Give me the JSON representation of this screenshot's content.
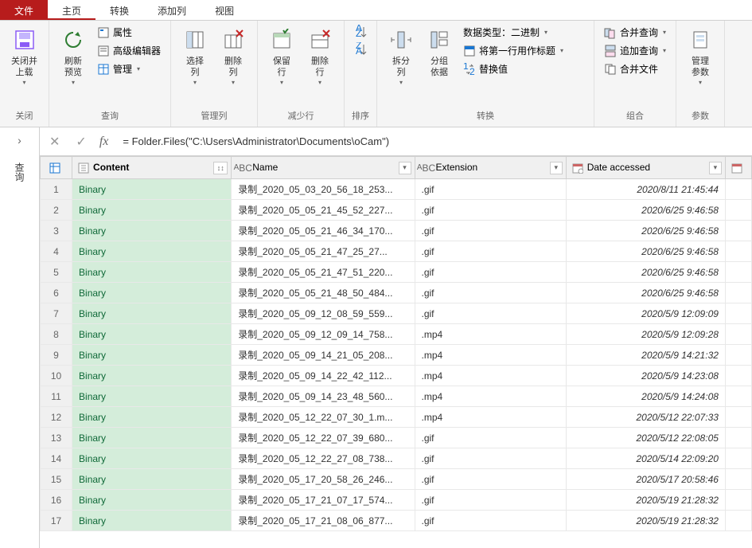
{
  "tabs": {
    "file": "文件",
    "home": "主页",
    "transform": "转换",
    "addcol": "添加列",
    "view": "视图"
  },
  "ribbon": {
    "close": {
      "closeload": "关闭并\n上载",
      "group": "关闭"
    },
    "query": {
      "refresh": "刷新\n预览",
      "props": "属性",
      "adveditor": "高级编辑器",
      "manage": "管理",
      "group": "查询"
    },
    "managecols": {
      "choose": "选择\n列",
      "remove": "删除\n列",
      "group": "管理列"
    },
    "reducerows": {
      "keep": "保留\n行",
      "removerows": "删除\n行",
      "group": "减少行"
    },
    "sort": {
      "group": "排序"
    },
    "split": {
      "splitcol": "拆分\n列",
      "groupby": "分组\n依据",
      "datatype": "数据类型：二进制",
      "firstrow": "将第一行用作标题",
      "replace": "替换值",
      "group": "转换"
    },
    "combine": {
      "merge": "合并查询",
      "append": "追加查询",
      "combinefiles": "合并文件",
      "group": "组合"
    },
    "params": {
      "manageparams": "管理\n参数",
      "group": "参数"
    }
  },
  "formula": "= Folder.Files(\"C:\\Users\\Administrator\\Documents\\oCam\")",
  "columns": {
    "content": "Content",
    "name": "Name",
    "extension": "Extension",
    "dateaccessed": "Date accessed"
  },
  "rows": [
    {
      "n": 1,
      "content": "Binary",
      "name": "录制_2020_05_03_20_56_18_253...",
      "ext": ".gif",
      "date": "2020/8/11 21:45:44"
    },
    {
      "n": 2,
      "content": "Binary",
      "name": "录制_2020_05_05_21_45_52_227...",
      "ext": ".gif",
      "date": "2020/6/25 9:46:58"
    },
    {
      "n": 3,
      "content": "Binary",
      "name": "录制_2020_05_05_21_46_34_170...",
      "ext": ".gif",
      "date": "2020/6/25 9:46:58"
    },
    {
      "n": 4,
      "content": "Binary",
      "name": "录制_2020_05_05_21_47_25_27...",
      "ext": ".gif",
      "date": "2020/6/25 9:46:58"
    },
    {
      "n": 5,
      "content": "Binary",
      "name": "录制_2020_05_05_21_47_51_220...",
      "ext": ".gif",
      "date": "2020/6/25 9:46:58"
    },
    {
      "n": 6,
      "content": "Binary",
      "name": "录制_2020_05_05_21_48_50_484...",
      "ext": ".gif",
      "date": "2020/6/25 9:46:58"
    },
    {
      "n": 7,
      "content": "Binary",
      "name": "录制_2020_05_09_12_08_59_559...",
      "ext": ".gif",
      "date": "2020/5/9 12:09:09"
    },
    {
      "n": 8,
      "content": "Binary",
      "name": "录制_2020_05_09_12_09_14_758...",
      "ext": ".mp4",
      "date": "2020/5/9 12:09:28"
    },
    {
      "n": 9,
      "content": "Binary",
      "name": "录制_2020_05_09_14_21_05_208...",
      "ext": ".mp4",
      "date": "2020/5/9 14:21:32"
    },
    {
      "n": 10,
      "content": "Binary",
      "name": "录制_2020_05_09_14_22_42_112...",
      "ext": ".mp4",
      "date": "2020/5/9 14:23:08"
    },
    {
      "n": 11,
      "content": "Binary",
      "name": "录制_2020_05_09_14_23_48_560...",
      "ext": ".mp4",
      "date": "2020/5/9 14:24:08"
    },
    {
      "n": 12,
      "content": "Binary",
      "name": "录制_2020_05_12_22_07_30_1.m...",
      "ext": ".mp4",
      "date": "2020/5/12 22:07:33"
    },
    {
      "n": 13,
      "content": "Binary",
      "name": "录制_2020_05_12_22_07_39_680...",
      "ext": ".gif",
      "date": "2020/5/12 22:08:05"
    },
    {
      "n": 14,
      "content": "Binary",
      "name": "录制_2020_05_12_22_27_08_738...",
      "ext": ".gif",
      "date": "2020/5/14 22:09:20"
    },
    {
      "n": 15,
      "content": "Binary",
      "name": "录制_2020_05_17_20_58_26_246...",
      "ext": ".gif",
      "date": "2020/5/17 20:58:46"
    },
    {
      "n": 16,
      "content": "Binary",
      "name": "录制_2020_05_17_21_07_17_574...",
      "ext": ".gif",
      "date": "2020/5/19 21:28:32"
    },
    {
      "n": 17,
      "content": "Binary",
      "name": "录制_2020_05_17_21_08_06_877...",
      "ext": ".gif",
      "date": "2020/5/19 21:28:32"
    }
  ]
}
